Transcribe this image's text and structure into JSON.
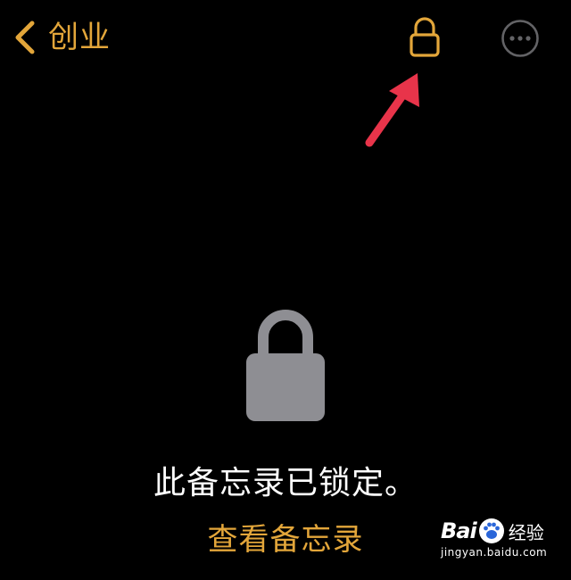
{
  "nav": {
    "back_label": "创业",
    "back_icon": "chevron-left-icon",
    "lock_icon": "lock-icon",
    "more_icon": "ellipsis-circle-icon"
  },
  "annotation": {
    "arrow_color": "#E8344A"
  },
  "locked_view": {
    "icon": "lock-icon",
    "message": "此备忘录已锁定。",
    "view_button_label": "查看备忘录"
  },
  "watermark": {
    "brand_left": "Bai",
    "brand_right": "经验",
    "url": "jingyan.baidu.com"
  },
  "colors": {
    "background": "#000000",
    "accent": "#E3A63A",
    "lock_gray": "#8E8E93",
    "more_gray": "#636366",
    "arrow_red": "#E8344A",
    "text_white": "#FFFFFF"
  }
}
